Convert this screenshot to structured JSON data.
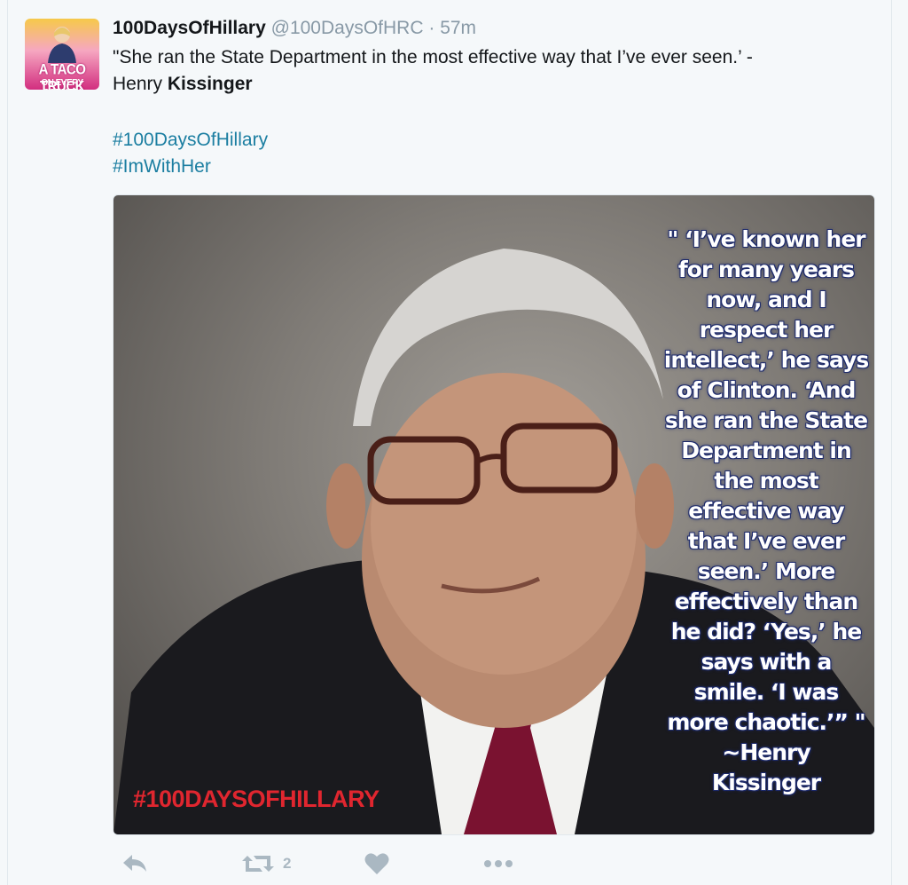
{
  "tweet": {
    "display_name": "100DaysOfHillary",
    "handle": "@100DaysOfHRC",
    "separator": "·",
    "timestamp": "57m",
    "text_main": "\"She ran the State Department in the most effective way that I’ve ever seen.’ -",
    "text_line2_prefix": "Henry ",
    "text_line2_bold": "Kissinger",
    "hashtags": [
      "#100DaysOfHillary",
      "#ImWithHer"
    ]
  },
  "avatar": {
    "line1": "A TACO TRUCK",
    "line2": "ON EVERY CORNER!"
  },
  "media": {
    "quote_lines": [
      "\" ‘I’ve known her",
      "for many years",
      "now, and I",
      "respect her",
      "intellect,’ he says",
      "of Clinton. ‘And",
      "she ran the State",
      "Department in",
      "the most",
      "effective way",
      "that I’ve ever",
      "seen.’ More",
      "effectively than",
      "he did? ‘Yes,’ he",
      "says with a",
      "smile. ‘I was",
      "more chaotic.’” \"",
      "~Henry",
      "Kissinger"
    ],
    "image_hashtag": "#100DAYSOFHILLARY"
  },
  "actions": {
    "reply_icon": "reply-icon",
    "retweet_icon": "retweet-icon",
    "retweet_count": "2",
    "like_icon": "heart-icon",
    "more_icon": "more-icon"
  },
  "colors": {
    "link": "#1b7ea1",
    "muted": "#8899a6",
    "image_hashtag": "#e0262f",
    "quote_outline": "#1d2a6b"
  }
}
